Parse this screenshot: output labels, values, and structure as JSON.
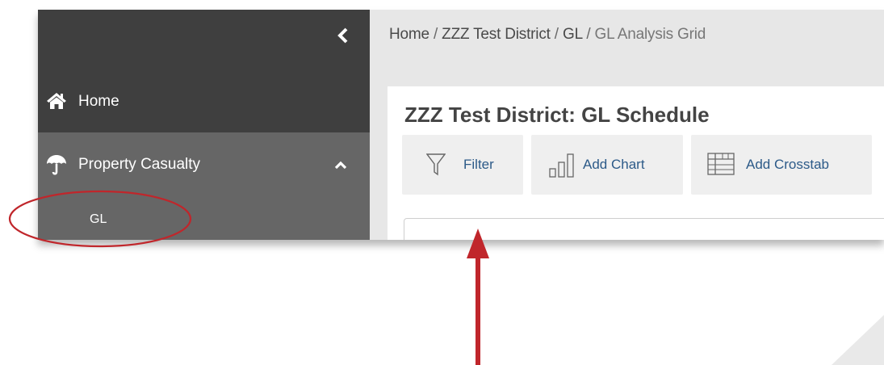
{
  "sidebar": {
    "collapse_icon": "chevron-left-icon",
    "items": [
      {
        "label": "Home",
        "icon": "home-icon"
      },
      {
        "label": "Property Casualty",
        "icon": "umbrella-icon",
        "chevron": "chevron-up-icon"
      },
      {
        "label": "GL"
      }
    ]
  },
  "breadcrumb": {
    "items": [
      "Home",
      "ZZZ Test District",
      "GL"
    ],
    "separator": "/",
    "current": "GL Analysis Grid"
  },
  "main": {
    "title": "ZZZ Test District: GL Schedule",
    "toolbar": [
      {
        "label": "Filter",
        "icon": "filter-icon"
      },
      {
        "label": "Add Chart",
        "icon": "bar-chart-icon"
      },
      {
        "label": "Add Crosstab",
        "icon": "table-icon"
      }
    ]
  },
  "colors": {
    "sidebar_dark": "#3f3f3f",
    "sidebar": "#666666",
    "content_bg": "#e7e7e7",
    "link": "#2c5a88",
    "annotation": "#c0262b"
  }
}
